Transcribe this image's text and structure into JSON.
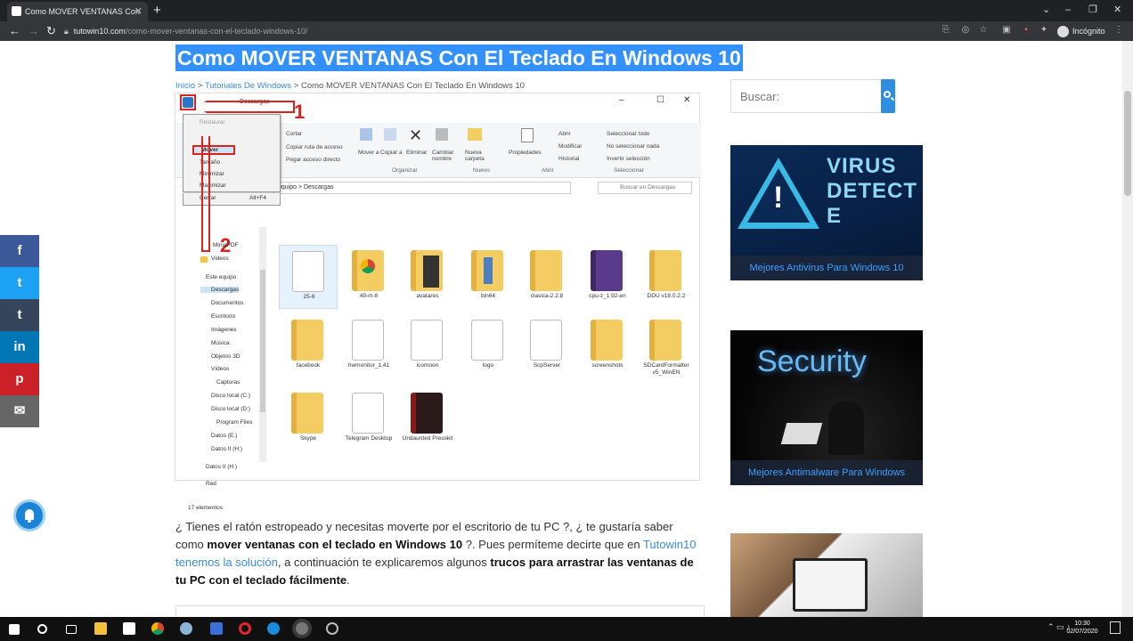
{
  "browser": {
    "tab_title": "Como MOVER VENTANAS Con",
    "tab_close": "✕",
    "new_tab": "+",
    "url_domain": "tutowin10.com",
    "url_path": "/como-mover-ventanas-con-el-teclado-windows-10/",
    "incognito_label": "Incógnito",
    "window_controls": [
      "⌄",
      "–",
      "❐",
      "✕"
    ]
  },
  "page": {
    "title": "Como MOVER VENTANAS Con El Teclado En Windows 10",
    "breadcrumb": {
      "home": "Inicio",
      "sep1": " > ",
      "category": "Tutoriales De Windows",
      "sep2": " > ",
      "current": "Como MOVER VENTANAS Con El Teclado En Windows 10"
    },
    "search_placeholder": "Buscar:",
    "sidebar_cards": [
      {
        "caption": "Mejores Antivirus Para Windows 10",
        "img_text": "VIRUS DETECTE"
      },
      {
        "caption": "Mejores Antimalware Para Windows",
        "img_text": "Security"
      },
      {
        "caption": ""
      }
    ],
    "article": {
      "p1_a": "¿ Tienes el ratón estropeado y necesitas moverte por el escritorio de tu PC ?, ¿ te gustaría saber como ",
      "p1_b": "mover ventanas con el teclado en Windows 10",
      "p1_c": " ?. Pues permíteme decirte que en ",
      "p1_link1": "Tutowin10 tenemos la solución",
      "p1_d": ", a continuación te explicaremos algunos ",
      "p1_e": "trucos para arrastrar las ventanas de tu PC con el teclado fácilmente",
      "p1_f": "."
    }
  },
  "screenshot": {
    "window_title": "Descargas",
    "annot_1": "1",
    "annot_2": "2",
    "menu": {
      "restaurar": "Restaurar",
      "mover": "Mover",
      "tamano": "Tamaño",
      "minimizar": "Minimizar",
      "maximizar": "Maximizar",
      "cerrar": "Cerrar",
      "cerrar_shortcut": "Alt+F4"
    },
    "ribbon": {
      "cortar": "Cortar",
      "copiar_ruta": "Copiar ruta de acceso",
      "pegar_acceso": "Pegar acceso directo",
      "mover_a": "Mover a",
      "copiar_a": "Copiar a",
      "eliminar": "Eliminar",
      "cambiar_nombre": "Cambiar nombre",
      "nueva_carpeta": "Nueva carpeta",
      "propiedades": "Propiedades",
      "abrir": "Abrir",
      "modificar": "Modificar",
      "historial": "Historial",
      "sel_todo": "Seleccionar todo",
      "no_sel": "No seleccionar nada",
      "invertir": "Invertir selección",
      "g_organizar": "Organizar",
      "g_nuevo": "Nuevo",
      "g_abrir": "Abrir",
      "g_seleccionar": "Seleccionar"
    },
    "address": "equipo  >  Descargas",
    "search_placeholder": "Buscar en Descargas",
    "status": "17 elementos",
    "nav_items": [
      "MiniaPDF",
      "Videos",
      "Este equipo",
      "Descargas",
      "Documentos",
      "Escritorio",
      "Imágenes",
      "Música",
      "Objetos 3D",
      "Vídeos",
      "Capturas",
      "Disco local (C:)",
      "Disco local (D:)",
      "Program Files",
      "Datos (E:)",
      "Datos II (H:)",
      "Datos II (H:)",
      "Red"
    ],
    "files": [
      "25-6",
      "49-m-8",
      "avatares",
      "bin64",
      "clasica-2.2.8",
      "cpu-z_1.92-en",
      "DDU v18.0.2.2",
      "facebook",
      "hwmonitor_1.41",
      "icomoon",
      "logo",
      "ScpServer",
      "screenshots",
      "SDCardFormatter v5_WinEN",
      "Skype",
      "Telegram Desktop",
      "Undaunted Presskit"
    ]
  },
  "share": {
    "facebook": "f",
    "twitter": "t",
    "tumblr": "t",
    "linkedin": "in",
    "pinterest": "p",
    "email": "✉"
  },
  "taskbar": {
    "time": "10:30",
    "date": "02/07/2020"
  },
  "colors": {
    "accent": "#3391ff",
    "link": "#3a8dde",
    "facebook": "#3b5998",
    "twitter": "#1da1f2",
    "tumblr": "#35465c",
    "linkedin": "#0077b5",
    "pinterest": "#cb2027",
    "email": "#666666"
  }
}
